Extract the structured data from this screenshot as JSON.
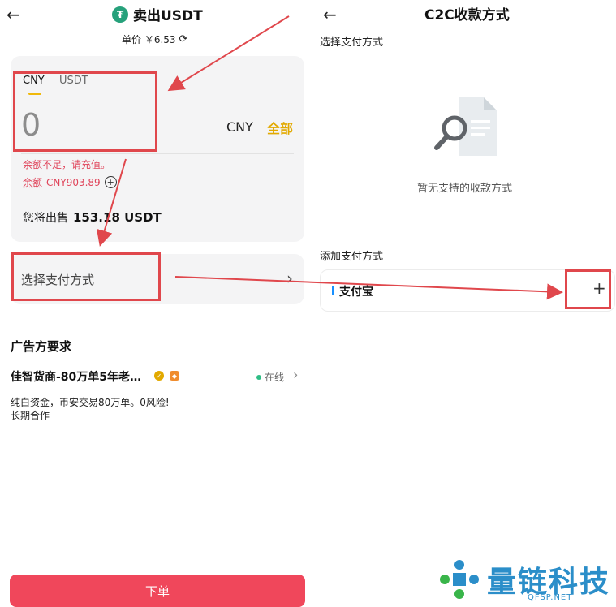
{
  "left": {
    "back_icon": "arrow-left-icon",
    "title": "卖出USDT",
    "price": "单价 ￥6.53",
    "tabs": [
      "CNY",
      "USDT"
    ],
    "amount": "0",
    "currency": "CNY",
    "all_label": "全部",
    "warning": "余额不足，请充值。",
    "balance_prefix": "余额",
    "balance_value": "CNY903.89",
    "sell_prefix": "您将出售",
    "sell_value": "153.18 USDT",
    "pay_method_label": "选择支付方式",
    "ad_title": "广告方要求",
    "merchant_name": "佳智货商-80万单5年老…",
    "online_label": "在线",
    "desc_line1": "纯白资金，币安交易80万单。0风险!",
    "desc_line2": "长期合作",
    "order_button": "下单"
  },
  "right": {
    "title": "C2C收款方式",
    "select_label": "选择支付方式",
    "empty_text": "暂无支持的收款方式",
    "add_title": "添加支付方式",
    "alipay_label": "支付宝"
  },
  "watermark": {
    "text": "量链科技",
    "sub": "QFSP.NET"
  },
  "colors": {
    "accent_yellow": "#f0b90b",
    "warning_red": "#e0445a",
    "order_red": "#f0475b",
    "annotation_red": "#e0474c",
    "usdt_green": "#26a17b"
  }
}
